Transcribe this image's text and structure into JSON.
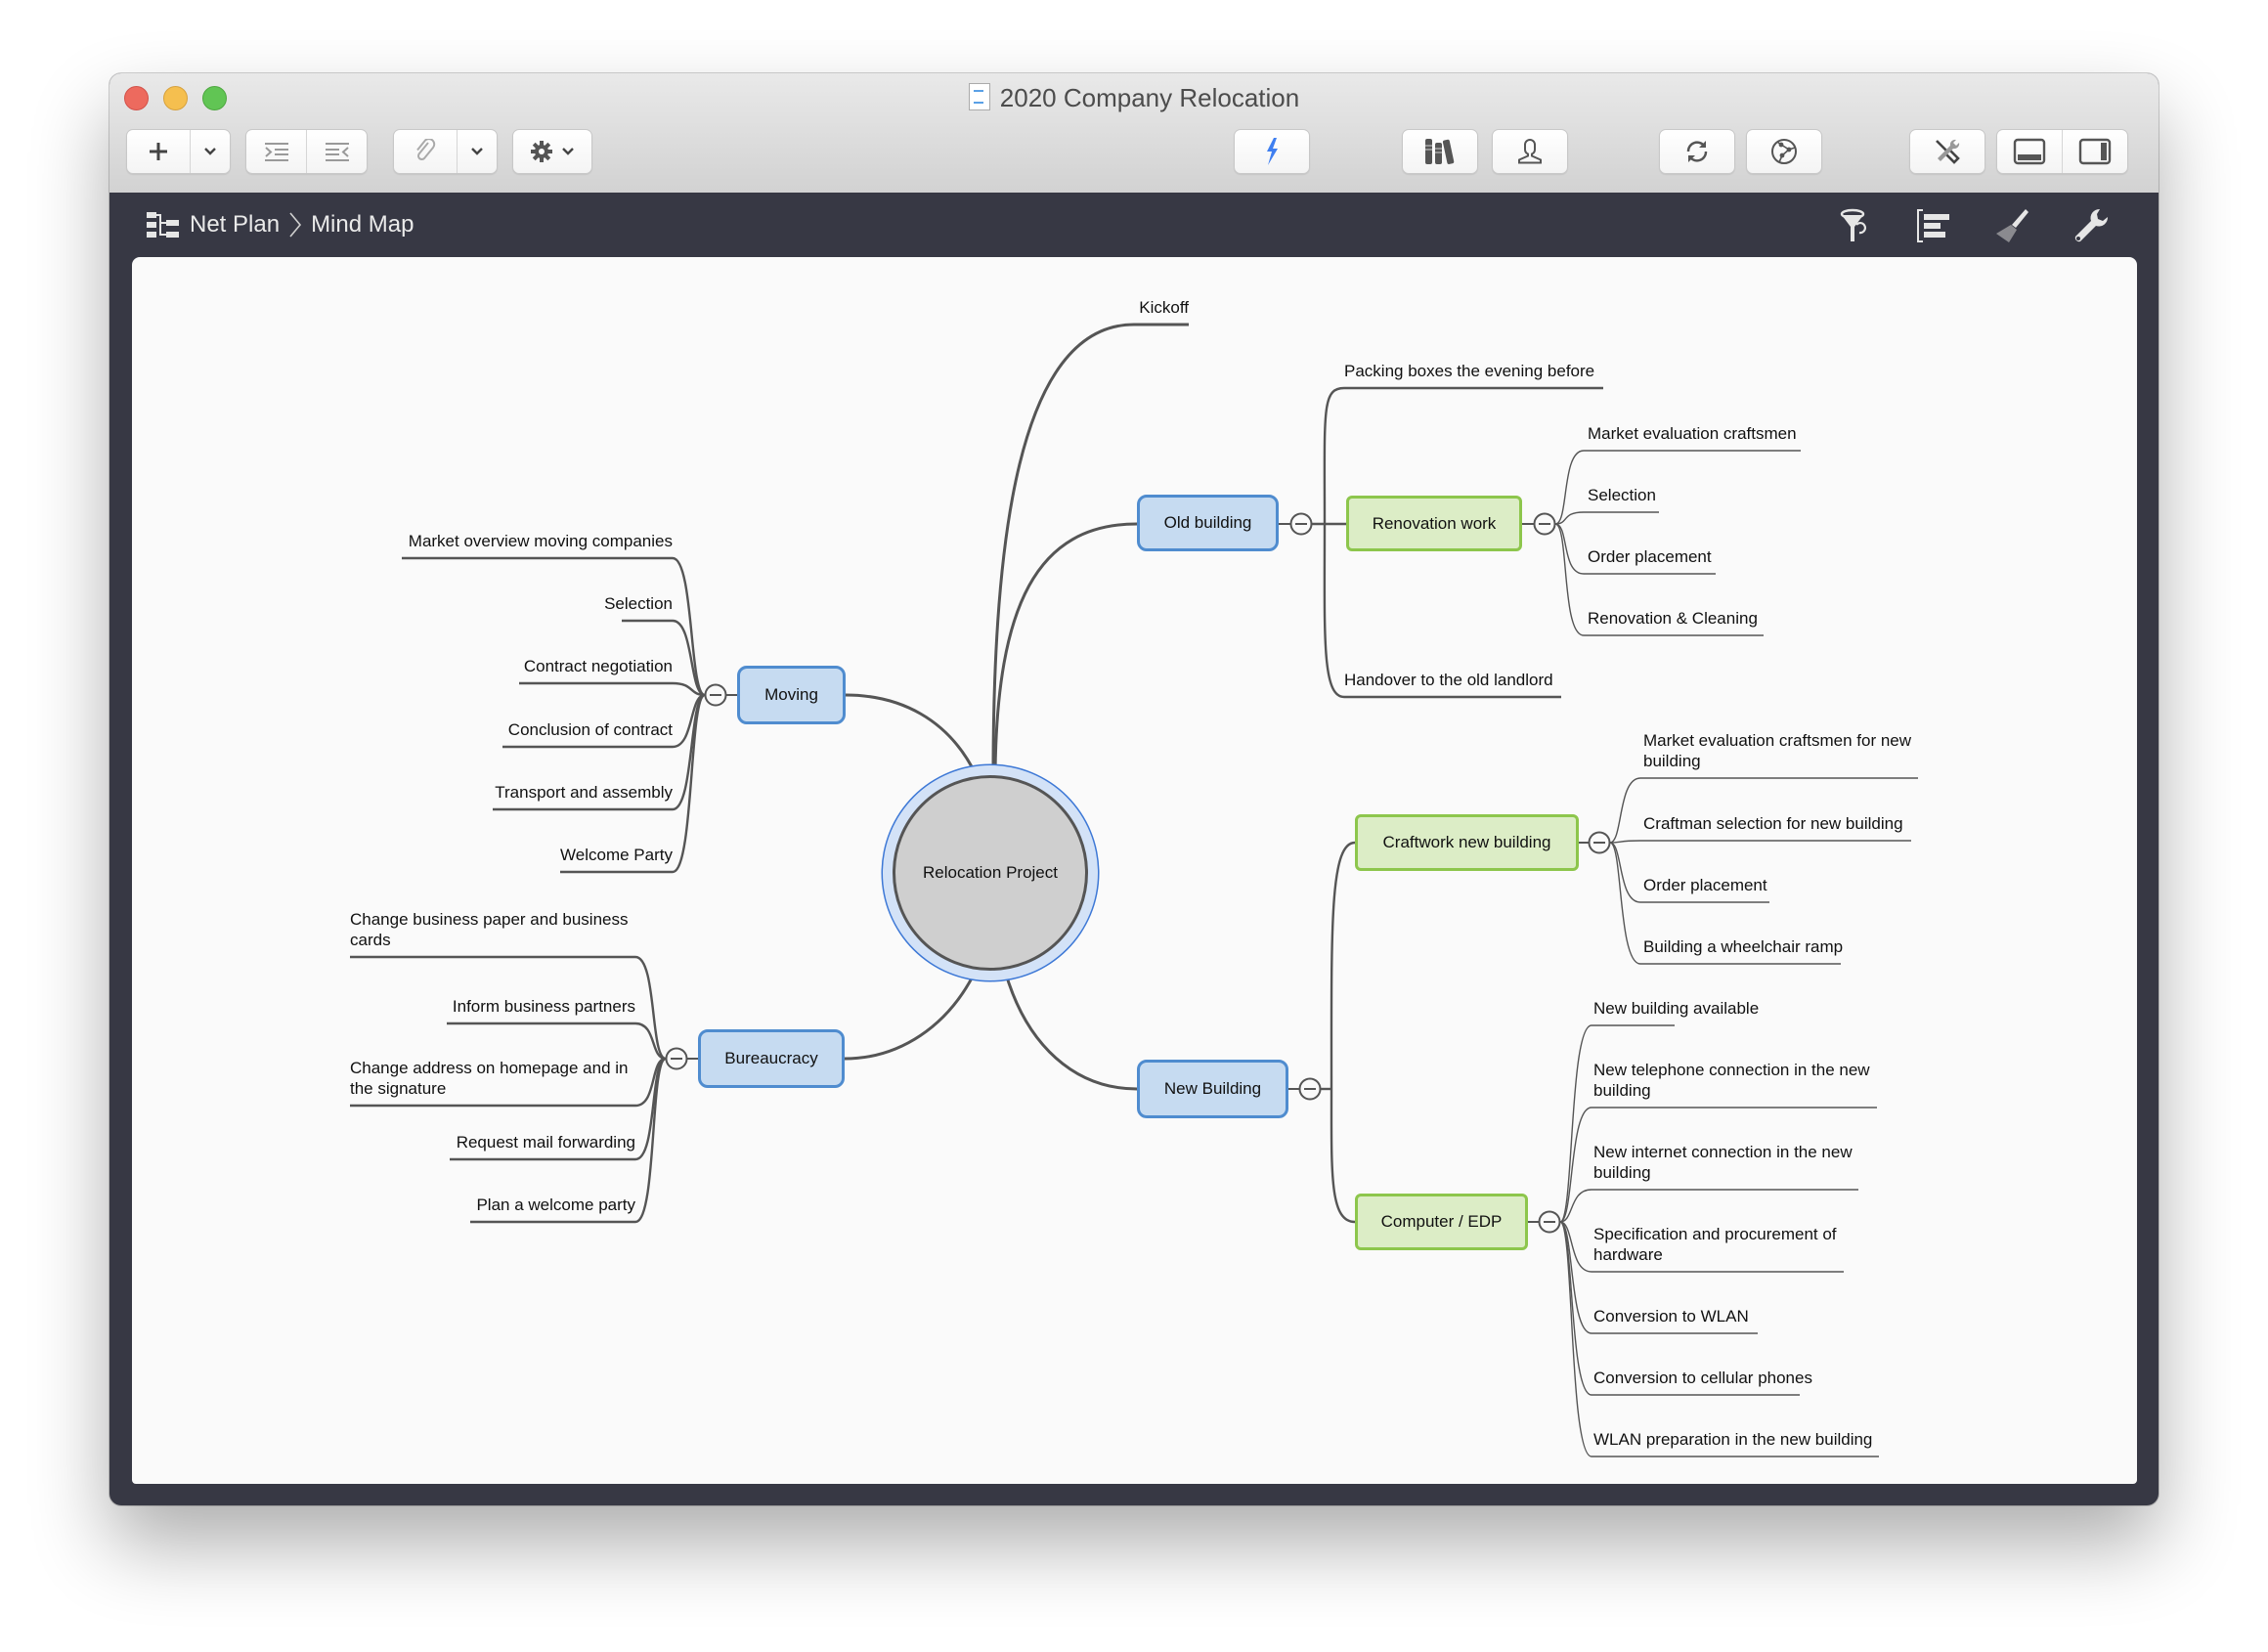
{
  "window": {
    "title": "2020 Company Relocation",
    "doc_icon": "document-icon"
  },
  "toolbar": {
    "add": {
      "icon": "plus-icon",
      "menu_icon": "chevron-down-icon"
    },
    "indent_icon": "indent-icon",
    "outdent_icon": "outdent-icon",
    "link": {
      "icon": "paperclip-icon",
      "menu_icon": "chevron-down-icon"
    },
    "settings": {
      "icon": "gear-icon",
      "menu_icon": "chevron-down-icon"
    },
    "lightning_icon": "lightning-icon",
    "library_icon": "books-icon",
    "resource_icon": "person-icon",
    "sync_icon": "sync-icon",
    "network_icon": "network-icon",
    "tools_icon": "tools-icon",
    "bottom_panel_icon": "bottom-panel-icon",
    "side_panel_icon": "side-panel-icon",
    "accent_color": "#3f7ff0"
  },
  "breadcrumb": {
    "items": [
      "Net Plan",
      "Mind Map"
    ],
    "separator": "›"
  },
  "viewbar": {
    "icons": [
      "filter-icon",
      "outline-icon",
      "brush-icon",
      "wrench-icon"
    ]
  },
  "mindmap": {
    "colors": {
      "main_fill": "#c6dbf1",
      "main_border": "#4f8ccf",
      "sub_fill": "#dcedc6",
      "sub_border": "#8dc64c",
      "root_fill": "#cfcfcf",
      "line": "#555555"
    },
    "root": "Relocation Project",
    "kickoff": "Kickoff",
    "moving": {
      "label": "Moving",
      "children": [
        "Market overview moving companies",
        "Selection",
        "Contract negotiation",
        "Conclusion of contract",
        "Transport and assembly",
        "Welcome Party"
      ]
    },
    "bureaucracy": {
      "label": "Bureaucracy",
      "children": [
        "Change business paper and business\ncards",
        "Inform business partners",
        "Change address on homepage and in\nthe signature",
        "Request mail forwarding",
        "Plan a welcome party"
      ]
    },
    "old_building": {
      "label": "Old building",
      "children_top": "Packing boxes the evening before",
      "renovation": {
        "label": "Renovation work",
        "children": [
          "Market evaluation craftsmen",
          "Selection",
          "Order placement",
          "Renovation & Cleaning"
        ]
      },
      "children_bottom": "Handover to the old landlord"
    },
    "new_building": {
      "label": "New Building",
      "craftwork": {
        "label": "Craftwork new building",
        "children": [
          "Market evaluation craftsmen for new\nbuilding",
          "Craftman selection for new building",
          "Order placement",
          "Building a wheelchair ramp"
        ]
      },
      "computer": {
        "label": "Computer / EDP",
        "children": [
          "New building available",
          "New telephone connection in the new\nbuilding",
          "New internet connection in the new\nbuilding",
          "Specification and procurement of\nhardware",
          "Conversion to WLAN",
          "Conversion to cellular phones",
          "WLAN preparation in the new building"
        ]
      }
    }
  }
}
